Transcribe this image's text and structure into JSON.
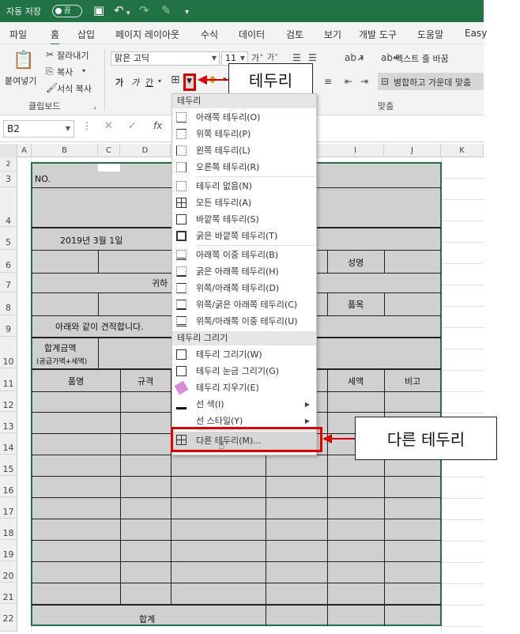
{
  "titlebar": {
    "autosave": "자동 저장",
    "toggle": "끔"
  },
  "tabs": [
    "파일",
    "홈",
    "삽입",
    "페이지 레이아웃",
    "수식",
    "데이터",
    "검토",
    "보기",
    "개발 도구",
    "도움말",
    "Easy"
  ],
  "ribbon": {
    "paste": "붙여넣기",
    "cut": "잘라내기",
    "copy": "복사",
    "format_painter": "서식 복사",
    "clipboard_group": "클립보드",
    "font_name": "맑은 고딕",
    "font_size": "11",
    "bold": "가",
    "italic": "가",
    "underline": "간",
    "wrap_text": "텍스트 줄 바꿈",
    "merge_center": "병합하고 가운데 맞춤",
    "align_group": "맞춤"
  },
  "callouts": {
    "border": "테두리",
    "more_borders": "다른 테두리"
  },
  "formula_bar": {
    "name_box": "B2",
    "fx": "fx"
  },
  "columns": [
    "A",
    "B",
    "C",
    "D",
    "I",
    "J",
    "K"
  ],
  "rows": [
    "2",
    "3",
    "4",
    "5",
    "6",
    "7",
    "8",
    "9",
    "10",
    "11",
    "12",
    "13",
    "14",
    "15",
    "16",
    "17",
    "18",
    "19",
    "20",
    "21",
    "22"
  ],
  "sheet": {
    "no": "NO.",
    "date": "2019년    3월     1일",
    "recipient": "귀하",
    "name_label": "성명",
    "item_label": "품목",
    "estimate_text": "아래와 같이 견적합니다.",
    "total_amount": "합계금액",
    "total_amount_sub": "(공급가액+세액)",
    "col_product": "품명",
    "col_spec": "규격",
    "col_tax": "세액",
    "col_note": "비고",
    "total": "합계"
  },
  "menu": {
    "section_borders": "테두리",
    "items1": [
      "아래쪽 테두리(O)",
      "위쪽 테두리(P)",
      "왼쪽 테두리(L)",
      "오른쪽 테두리(R)"
    ],
    "items2": [
      "테두리 없음(N)",
      "모든 테두리(A)",
      "바깥쪽 테두리(S)",
      "굵은 바깥쪽 테두리(T)"
    ],
    "items3": [
      "아래쪽 이중 테두리(B)",
      "굵은 아래쪽 테두리(H)",
      "위쪽/아래쪽 테두리(D)",
      "위쪽/굵은 아래쪽 테두리(C)",
      "위쪽/아래쪽 이중 테두리(U)"
    ],
    "section_draw": "테두리 그리기",
    "items4": [
      "테두리 그리기(W)",
      "테두리 눈금 그리기(G)",
      "테두리 지우기(E)",
      "선 색(I)",
      "선 스타일(Y)"
    ],
    "more": "다른 테두리(M)..."
  },
  "colors": {
    "excel_green": "#217346",
    "highlight_red": "#e00000",
    "cell_gray": "#d0d0d0"
  }
}
